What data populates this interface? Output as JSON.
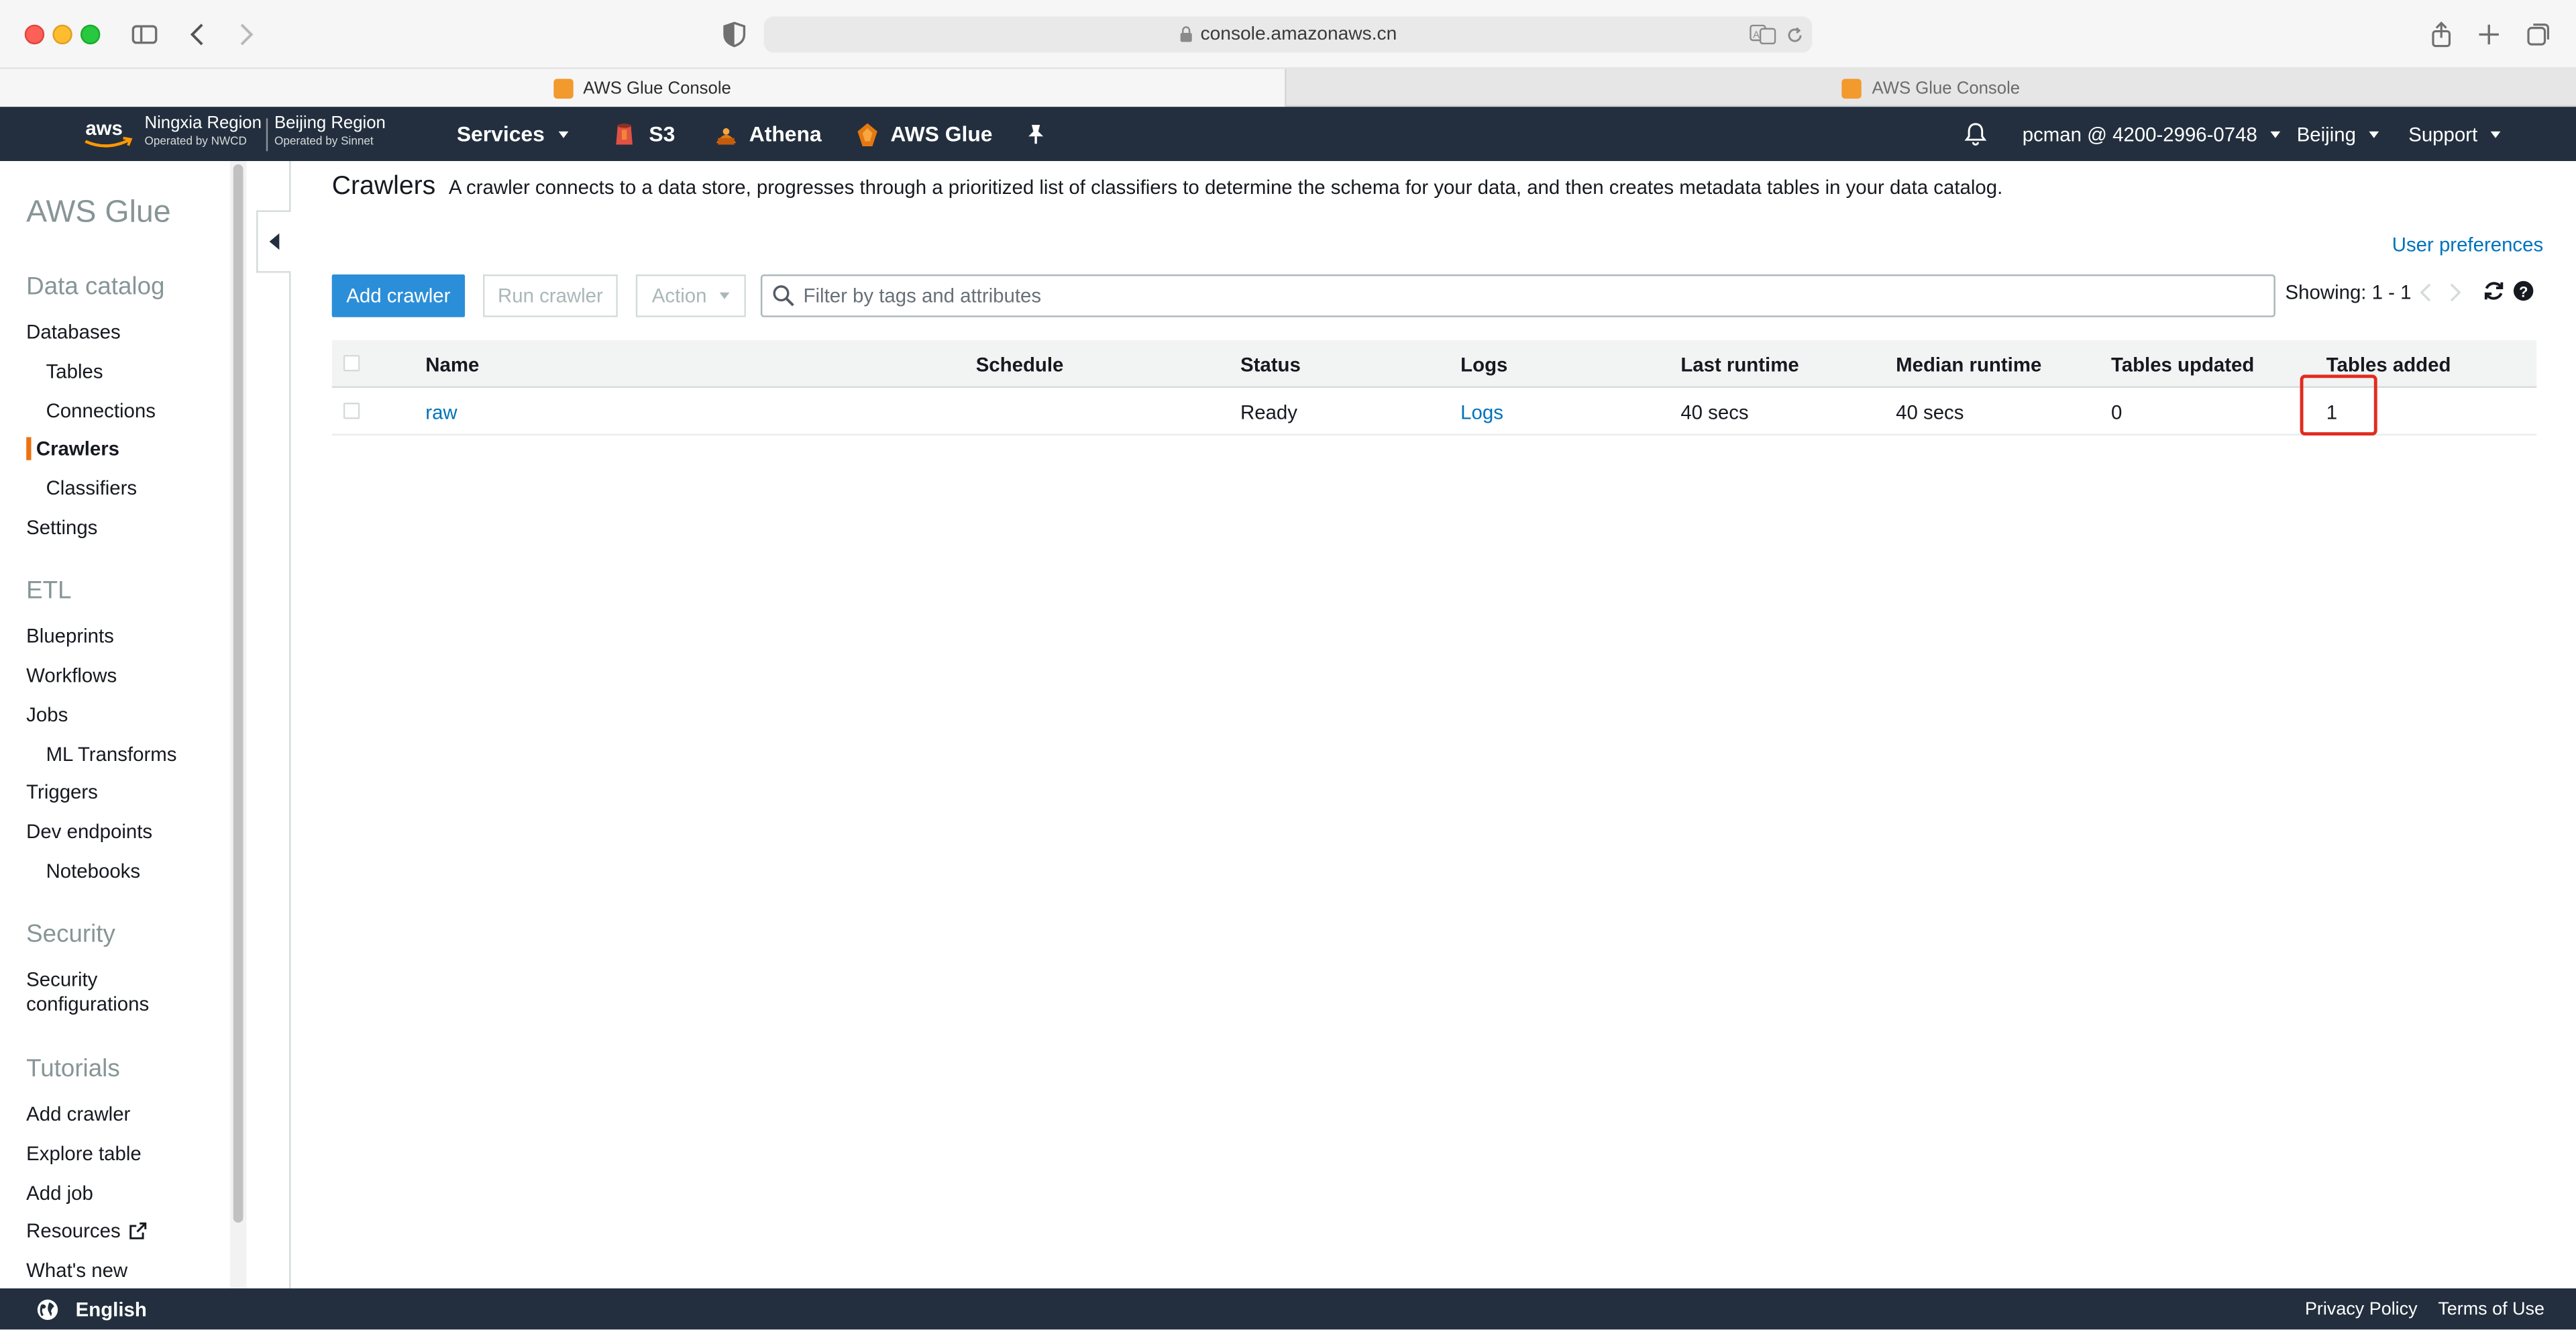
{
  "browser": {
    "url": "console.amazonaws.cn",
    "tabs": [
      {
        "label": "AWS Glue Console",
        "active": true
      },
      {
        "label": "AWS Glue Console",
        "active": false
      }
    ]
  },
  "header": {
    "regions": [
      {
        "name": "Ningxia Region",
        "operated_by": "Operated by NWCD"
      },
      {
        "name": "Beijing Region",
        "operated_by": "Operated by Sinnet"
      }
    ],
    "services_label": "Services",
    "shortcuts": [
      {
        "label": "S3",
        "icon": "s3-icon"
      },
      {
        "label": "Athena",
        "icon": "athena-icon"
      },
      {
        "label": "AWS Glue",
        "icon": "glue-icon"
      }
    ],
    "account": "pcman @ 4200-2996-0748",
    "region": "Beijing",
    "support": "Support",
    "colors": {
      "background": "#232f3e"
    }
  },
  "sidebar": {
    "title": "AWS Glue",
    "data_catalog": {
      "heading": "Data catalog",
      "items": [
        "Databases",
        "Tables",
        "Connections",
        "Crawlers",
        "Classifiers",
        "Settings"
      ]
    },
    "etl": {
      "heading": "ETL",
      "items": [
        "Blueprints",
        "Workflows",
        "Jobs",
        "ML Transforms",
        "Triggers",
        "Dev endpoints",
        "Notebooks"
      ]
    },
    "security": {
      "heading": "Security",
      "items": [
        "Security",
        "configurations"
      ]
    },
    "tutorials": {
      "heading": "Tutorials",
      "items": [
        "Add crawler",
        "Explore table",
        "Add job",
        "Resources",
        "What's new"
      ]
    },
    "active_item": "Crawlers",
    "colors": {
      "active_indicator": "#ec7211"
    }
  },
  "main": {
    "title": "Crawlers",
    "description": "A crawler connects to a data store, progresses through a prioritized list of classifiers to determine the schema for your data, and then creates metadata tables in your data catalog.",
    "user_preferences": "User preferences",
    "buttons": {
      "add_crawler": "Add crawler",
      "run_crawler": "Run crawler",
      "action": "Action"
    },
    "filter_placeholder": "Filter by tags and attributes",
    "showing": "Showing: 1 - 1",
    "table": {
      "columns": [
        "Name",
        "Schedule",
        "Status",
        "Logs",
        "Last runtime",
        "Median runtime",
        "Tables updated",
        "Tables added"
      ],
      "rows": [
        {
          "name": "raw",
          "schedule": "",
          "status": "Ready",
          "logs": "Logs",
          "last_runtime": "40 secs",
          "median_runtime": "40 secs",
          "tables_updated": "0",
          "tables_added": "1"
        }
      ]
    },
    "colors": {
      "primary_button": "#2b8ed8",
      "link": "#0073bb",
      "highlight": "#e22b20"
    }
  },
  "footer": {
    "language": "English",
    "links": [
      "Privacy Policy",
      "Terms of Use"
    ]
  }
}
